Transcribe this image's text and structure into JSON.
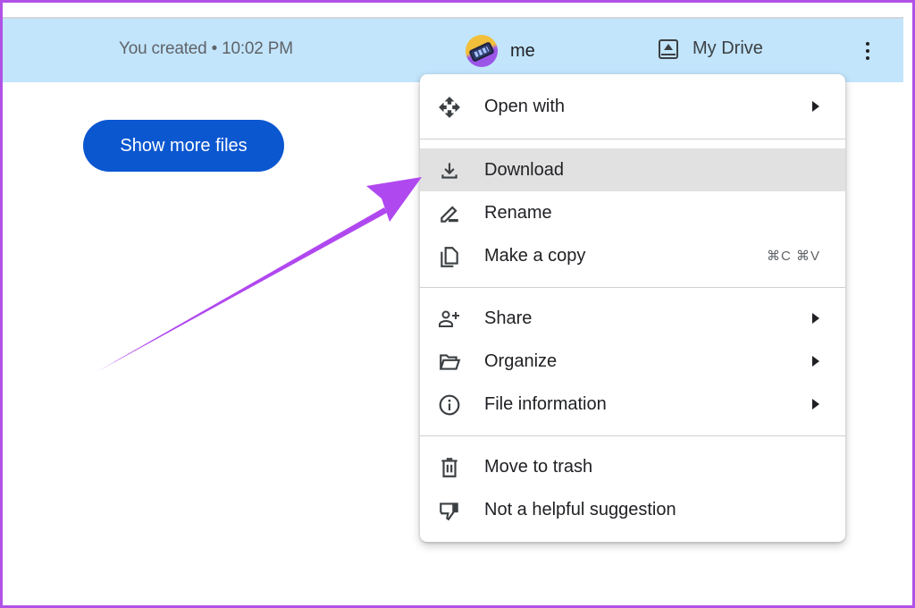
{
  "file_row": {
    "meta_text": "You created • 10:02 PM",
    "owner": {
      "avatar_icon": "avatar-phone-icon",
      "name": "me"
    },
    "location": {
      "icon": "my-drive-icon",
      "label": "My Drive"
    },
    "more_icon": "more-vert-icon"
  },
  "main": {
    "show_more_label": "Show more files",
    "button_color": "#0b57d0"
  },
  "context_menu": {
    "groups": [
      {
        "items": [
          {
            "label": "Open with",
            "icon": "open-with-icon",
            "has_submenu": true
          }
        ]
      },
      {
        "items": [
          {
            "label": "Download",
            "icon": "download-icon",
            "highlighted": true
          },
          {
            "label": "Rename",
            "icon": "rename-pencil-icon"
          },
          {
            "label": "Make a copy",
            "icon": "copy-icon",
            "shortcut": "⌘C ⌘V"
          }
        ]
      },
      {
        "items": [
          {
            "label": "Share",
            "icon": "person-add-icon",
            "has_submenu": true
          },
          {
            "label": "Organize",
            "icon": "folder-open-icon",
            "has_submenu": true
          },
          {
            "label": "File information",
            "icon": "info-icon",
            "has_submenu": true
          }
        ]
      },
      {
        "items": [
          {
            "label": "Move to trash",
            "icon": "trash-icon"
          },
          {
            "label": "Not a helpful suggestion",
            "icon": "thumb-down-icon"
          }
        ]
      }
    ]
  },
  "annotation": {
    "type": "arrow",
    "color": "#b048f0",
    "points_to": "Download"
  },
  "colors": {
    "frame_border": "#b052e6",
    "row_highlight": "#c2e5fc",
    "menu_hover": "#e1e1e1"
  }
}
